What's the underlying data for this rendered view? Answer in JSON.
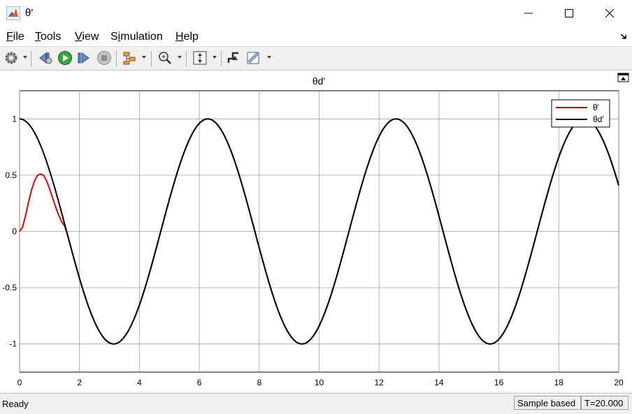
{
  "window": {
    "title": "θ'",
    "icon": "matlab-logo-icon"
  },
  "menu": {
    "items": [
      {
        "label": "File",
        "accel": "F"
      },
      {
        "label": "Tools",
        "accel": "T"
      },
      {
        "label": "View",
        "accel": "V"
      },
      {
        "label": "Simulation",
        "accel": "i"
      },
      {
        "label": "Help",
        "accel": "H"
      }
    ]
  },
  "toolbar": {
    "icons": [
      "settings-gear-icon",
      "step-back-icon",
      "run-icon",
      "step-forward-icon",
      "stop-icon",
      "signal-selector-icon",
      "zoom-in-icon",
      "fit-to-view-icon",
      "triggers-icon",
      "cursor-measurements-icon"
    ]
  },
  "plot": {
    "title": "θd'",
    "undock_icon": "undock-icon"
  },
  "chart_data": {
    "type": "line",
    "title": "θd'",
    "xlim": [
      0,
      20
    ],
    "ylim": [
      -1.25,
      1.25
    ],
    "xticks": [
      0,
      2,
      4,
      6,
      8,
      10,
      12,
      14,
      16,
      18,
      20
    ],
    "yticks": [
      1,
      0.5,
      0,
      -0.5,
      -1
    ],
    "ytick_labels": [
      "1",
      "0.5",
      "0",
      "-0.5",
      "-1"
    ],
    "grid": true,
    "legend": "top-right",
    "series": [
      {
        "name": "θ'",
        "color": "#e00000",
        "expression": "θd' = cos(t) after transient; starts at 0, peaks 0.51 near t=0.75, merges with θd' near t=1.5",
        "x": [
          0,
          0.1,
          0.2,
          0.3,
          0.4,
          0.5,
          0.6,
          0.7,
          0.8,
          0.9,
          1.0,
          1.1,
          1.2,
          1.3,
          1.4,
          1.5,
          1.6
        ],
        "y": [
          0,
          0.04,
          0.14,
          0.26,
          0.37,
          0.45,
          0.5,
          0.51,
          0.5,
          0.45,
          0.38,
          0.3,
          0.22,
          0.15,
          0.09,
          0.05,
          -0.03
        ]
      },
      {
        "name": "θd'",
        "color": "#000000",
        "x_range": [
          0,
          20
        ],
        "function": "cos"
      }
    ]
  },
  "status": {
    "left": "Ready",
    "mode": "Sample based",
    "time": "T=20.000"
  }
}
